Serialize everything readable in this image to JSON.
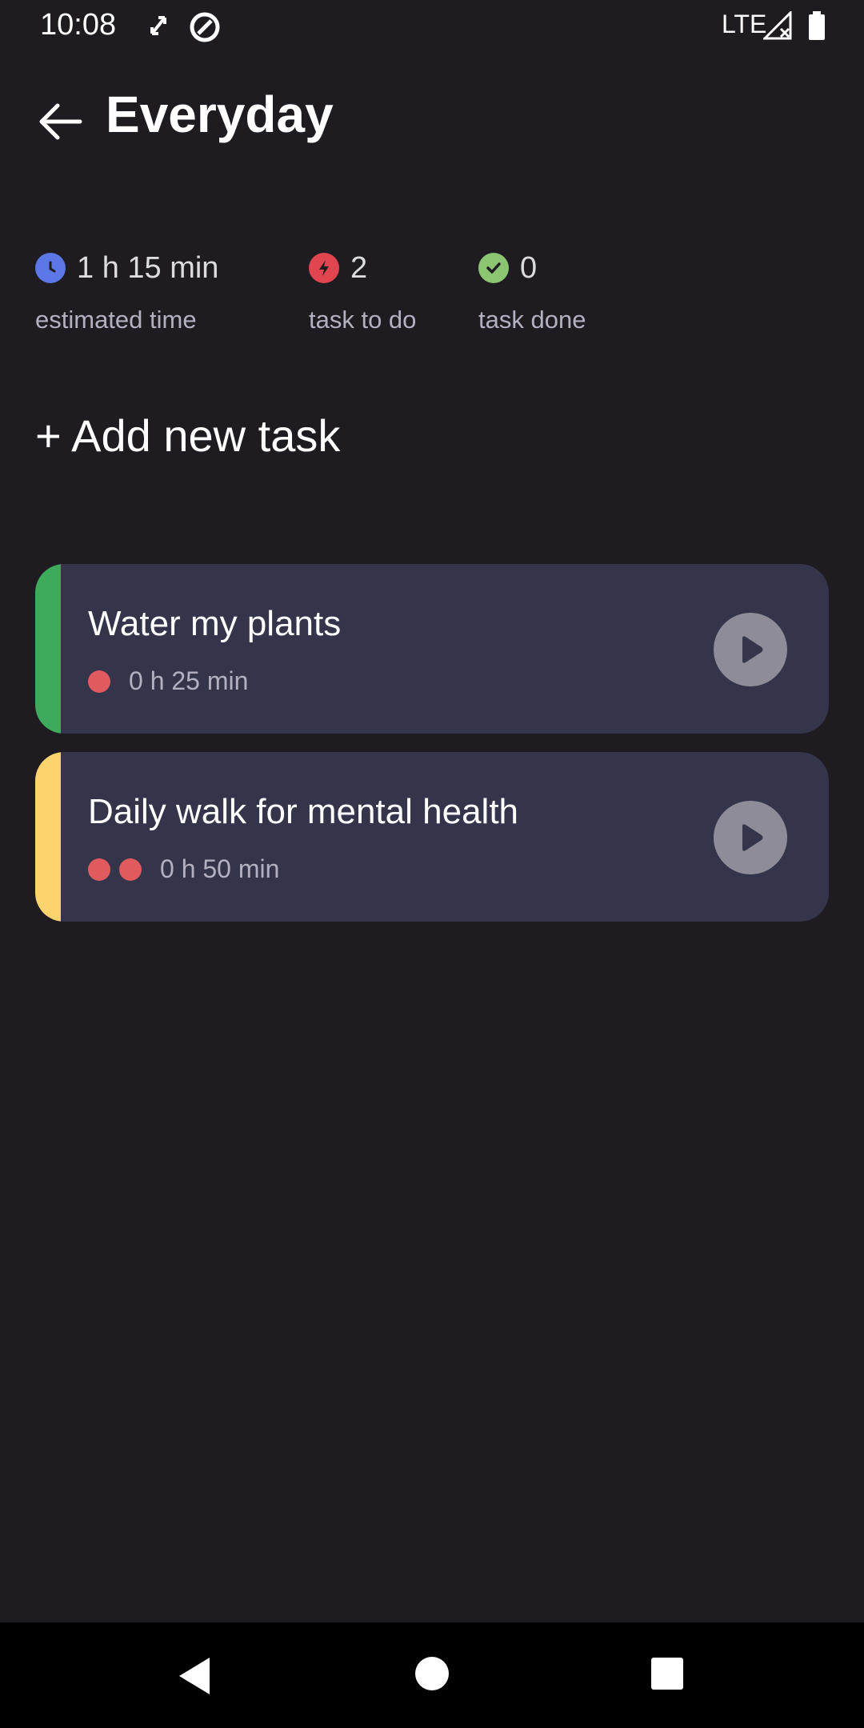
{
  "status_bar": {
    "time": "10:08",
    "network": "LTE",
    "icons": [
      "screen-rotate-icon",
      "data-saver-icon",
      "signal-icon",
      "battery-icon"
    ]
  },
  "header": {
    "back_icon": "arrow-left-icon",
    "title": "Everyday"
  },
  "stats": [
    {
      "icon": "clock-icon",
      "color": "#5b78e6",
      "value": "1 h 15 min",
      "label": "estimated time"
    },
    {
      "icon": "bolt-icon",
      "color": "#e04550",
      "value": "2",
      "label": "task to do"
    },
    {
      "icon": "check-icon",
      "color": "#8cc572",
      "value": "0",
      "label": "task done"
    }
  ],
  "add_task_label": "+ Add new task",
  "tasks": [
    {
      "title": "Water my plants",
      "duration": "0 h 25 min",
      "priority": 1,
      "stripe_color": "#3daa5c"
    },
    {
      "title": "Daily walk for mental health",
      "duration": "0 h 50 min",
      "priority": 2,
      "stripe_color": "#fdd36e"
    }
  ],
  "colors": {
    "background": "#1e1c21",
    "card": "#34354a",
    "priority_dot": "#e05a5e",
    "play_button": "#8e8c98"
  },
  "nav": [
    "back-triangle-icon",
    "home-circle-icon",
    "recents-square-icon"
  ]
}
